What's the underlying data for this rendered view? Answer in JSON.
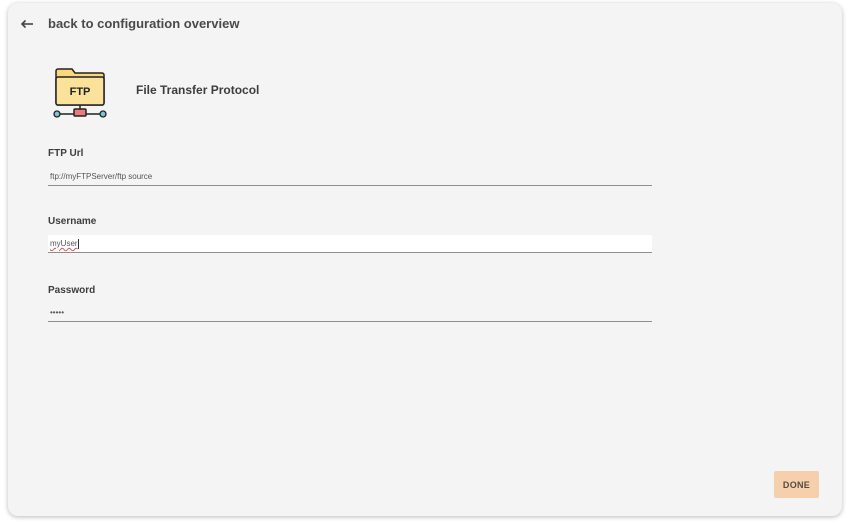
{
  "navigation": {
    "back_label": "back to configuration overview"
  },
  "header": {
    "icon_text": "FTP",
    "title": "File Transfer Protocol"
  },
  "form": {
    "ftp_url": {
      "label": "FTP Url",
      "value": "ftp://myFTPServer/ftp source"
    },
    "username": {
      "label": "Username",
      "value": "myUser"
    },
    "password": {
      "label": "Password",
      "value": "•••••"
    }
  },
  "actions": {
    "done_label": "DONE"
  },
  "colors": {
    "panel_bg": "#f4f4f4",
    "done_button_bg": "#f6cfad",
    "folder_yellow": "#f9d77a",
    "connector_red": "#e97b7b",
    "node_blue": "#7fc3d6"
  }
}
